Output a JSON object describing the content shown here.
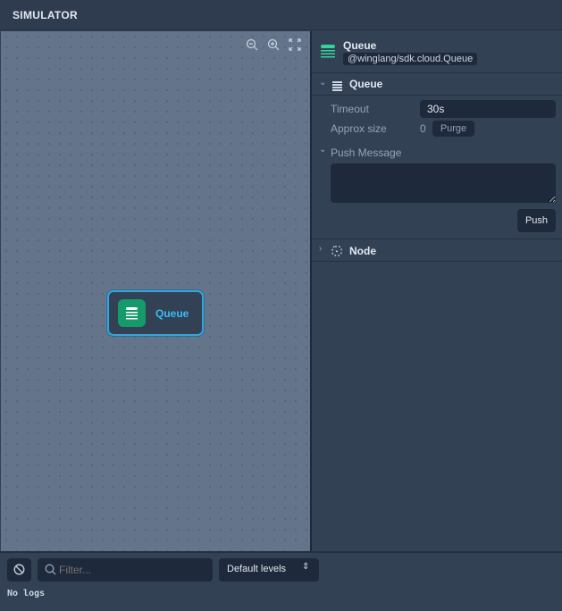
{
  "header": {
    "title": "SIMULATOR"
  },
  "canvas": {
    "controls": [
      "zoom-out-icon",
      "zoom-in-icon",
      "fit-screen-icon"
    ],
    "node": {
      "label": "Queue",
      "icon": "queue-icon"
    }
  },
  "details": {
    "title": "Queue",
    "type": "@winglang/sdk.cloud.Queue",
    "section_queue": "Queue",
    "timeout_label": "Timeout",
    "timeout_value": "30s",
    "size_label": "Approx size",
    "size_value": "0",
    "purge_label": "Purge",
    "push_section": "Push Message",
    "push_value": "",
    "push_label": "Push",
    "section_node": "Node"
  },
  "logs": {
    "filter_placeholder": "Filter...",
    "levels_value": "Default levels",
    "empty_text": "No logs"
  },
  "colors": {
    "accent": "#38bdf8",
    "queue_green": "#159a6c"
  }
}
